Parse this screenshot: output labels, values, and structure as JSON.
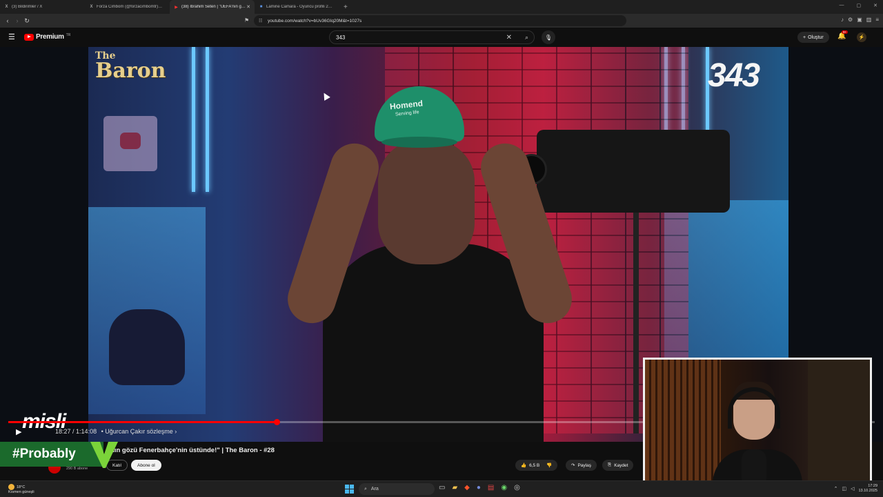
{
  "browser": {
    "tabs": [
      {
        "icon": "x-logo",
        "label": "(3) Bildirimler / X",
        "active": false
      },
      {
        "icon": "x-logo",
        "label": "Forza Cimbom (@forzacimbomtr) / X",
        "active": false
      },
      {
        "icon": "youtube-icon",
        "label": "(38) İbrahim Seten | \"UEFA'nın gözü",
        "active": true
      },
      {
        "icon": "transfermarkt-icon",
        "label": "Lamine Camara - Oyuncu profili 25/26",
        "active": false
      }
    ],
    "new_tab": "+",
    "url": "youtube.com/watch?v=bUv36GIq20M&t=1027s"
  },
  "youtube": {
    "brand": "Premium",
    "region": "TR",
    "search_value": "343",
    "create_label": "Oluştur",
    "notification_count": "9+",
    "colors": {
      "accent": "#ff0000",
      "background": "#0f0f0f"
    }
  },
  "video": {
    "overlay_logo_left": {
      "the": "The",
      "baron": "Baron"
    },
    "overlay_logo_right": "343",
    "cap_text": "Homend",
    "cap_subtext": "Serving life",
    "time_current": "18:27",
    "time_total": "1:14:08",
    "chapter": "• Uğurcan Çakır sözleşme ›",
    "progress_fraction": 0.31,
    "sponsor": "misli"
  },
  "details": {
    "title": "nın gözü Fenerbahçe'nin üstünde!\" | The Baron - #28",
    "subscribers": "290 B abone",
    "join_label": "Katıl",
    "subscribe_label": "Abone ol",
    "like_count": "6,5 B",
    "share_label": "Paylaş",
    "save_label": "Kaydet"
  },
  "overlay_banner": "#Probably",
  "taskbar": {
    "weather_temp": "18°C",
    "weather_desc": "Kısmen güneşli",
    "search_placeholder": "Ara",
    "time": "17:29",
    "date": "13.10.2025"
  }
}
